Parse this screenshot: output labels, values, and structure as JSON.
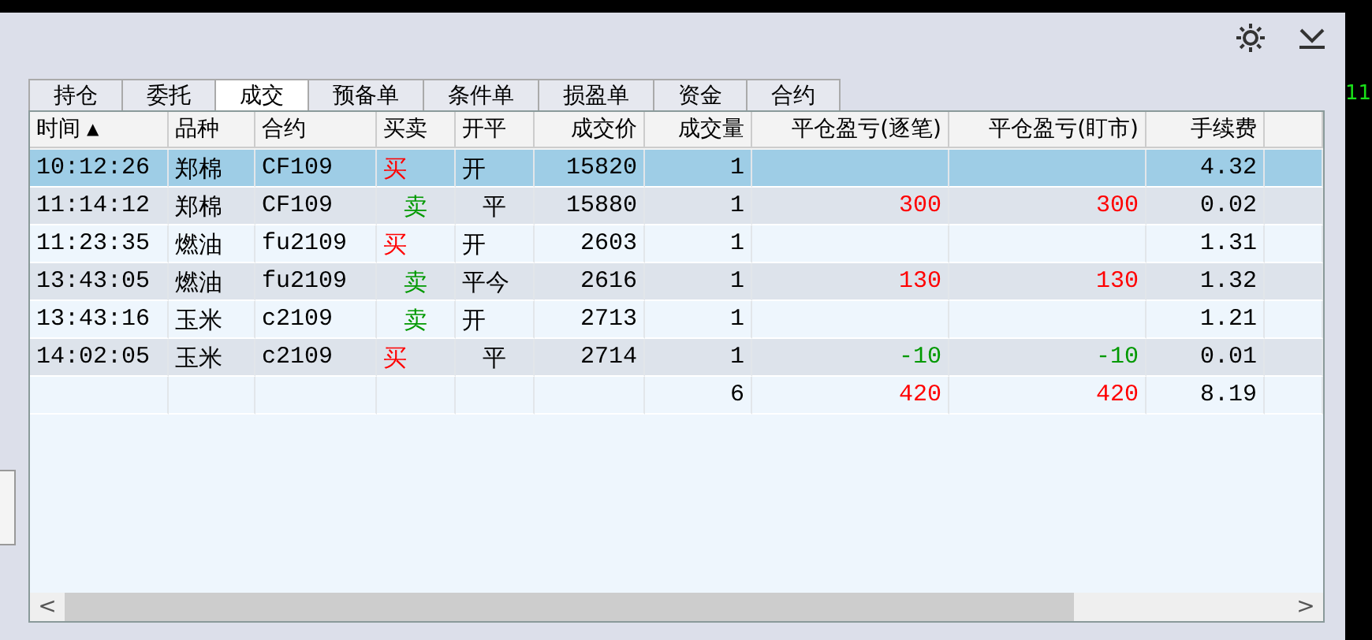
{
  "tabs": [
    {
      "label": "持仓",
      "selected": false
    },
    {
      "label": "委托",
      "selected": false
    },
    {
      "label": "成交",
      "selected": true
    },
    {
      "label": "预备单",
      "selected": false
    },
    {
      "label": "条件单",
      "selected": false
    },
    {
      "label": "损盈单",
      "selected": false
    },
    {
      "label": "资金",
      "selected": false
    },
    {
      "label": "合约",
      "selected": false
    }
  ],
  "side_panel": {
    "reading": "11"
  },
  "table": {
    "columns": [
      {
        "label": "时间",
        "sort": "▲"
      },
      {
        "label": "品种"
      },
      {
        "label": "合约"
      },
      {
        "label": "买卖"
      },
      {
        "label": "开平"
      },
      {
        "label": "成交价"
      },
      {
        "label": "成交量"
      },
      {
        "label": "平仓盈亏(逐笔)"
      },
      {
        "label": "平仓盈亏(盯市)"
      },
      {
        "label": "手续费"
      }
    ],
    "rows": [
      {
        "selected": true,
        "time": "10:12:26",
        "product": "郑棉",
        "contract": "CF109",
        "side": {
          "text": "买",
          "kind": "buy"
        },
        "offset": {
          "text": "开",
          "kind": "open"
        },
        "price": "15820",
        "qty": "1",
        "pnl_trade": null,
        "pnl_mark": null,
        "fee": "4.32"
      },
      {
        "selected": false,
        "time": "11:14:12",
        "product": "郑棉",
        "contract": "CF109",
        "side": {
          "text": "卖",
          "kind": "sell"
        },
        "offset": {
          "text": "平",
          "kind": "close"
        },
        "price": "15880",
        "qty": "1",
        "pnl_trade": {
          "text": "300",
          "color": "#ff0000"
        },
        "pnl_mark": {
          "text": "300",
          "color": "#ff0000"
        },
        "fee": "0.02"
      },
      {
        "selected": false,
        "time": "11:23:35",
        "product": "燃油",
        "contract": "fu2109",
        "side": {
          "text": "买",
          "kind": "buy"
        },
        "offset": {
          "text": "开",
          "kind": "open"
        },
        "price": "2603",
        "qty": "1",
        "pnl_trade": null,
        "pnl_mark": null,
        "fee": "1.31"
      },
      {
        "selected": false,
        "time": "13:43:05",
        "product": "燃油",
        "contract": "fu2109",
        "side": {
          "text": "卖",
          "kind": "sell"
        },
        "offset": {
          "text": "平今",
          "kind": "open"
        },
        "price": "2616",
        "qty": "1",
        "pnl_trade": {
          "text": "130",
          "color": "#ff0000"
        },
        "pnl_mark": {
          "text": "130",
          "color": "#ff0000"
        },
        "fee": "1.32"
      },
      {
        "selected": false,
        "time": "13:43:16",
        "product": "玉米",
        "contract": "c2109",
        "side": {
          "text": "卖",
          "kind": "sell"
        },
        "offset": {
          "text": "开",
          "kind": "open"
        },
        "price": "2713",
        "qty": "1",
        "pnl_trade": null,
        "pnl_mark": null,
        "fee": "1.21"
      },
      {
        "selected": false,
        "time": "14:02:05",
        "product": "玉米",
        "contract": "c2109",
        "side": {
          "text": "买",
          "kind": "buy"
        },
        "offset": {
          "text": "平",
          "kind": "close"
        },
        "price": "2714",
        "qty": "1",
        "pnl_trade": {
          "text": "-10",
          "color": "#009900"
        },
        "pnl_mark": {
          "text": "-10",
          "color": "#009900"
        },
        "fee": "0.01"
      }
    ],
    "totals": {
      "qty": "6",
      "pnl_trade": {
        "text": "420",
        "color": "#ff0000"
      },
      "pnl_mark": {
        "text": "420",
        "color": "#ff0000"
      },
      "fee": "8.19"
    }
  },
  "scrollbar": {
    "left": "<",
    "right": ">"
  }
}
